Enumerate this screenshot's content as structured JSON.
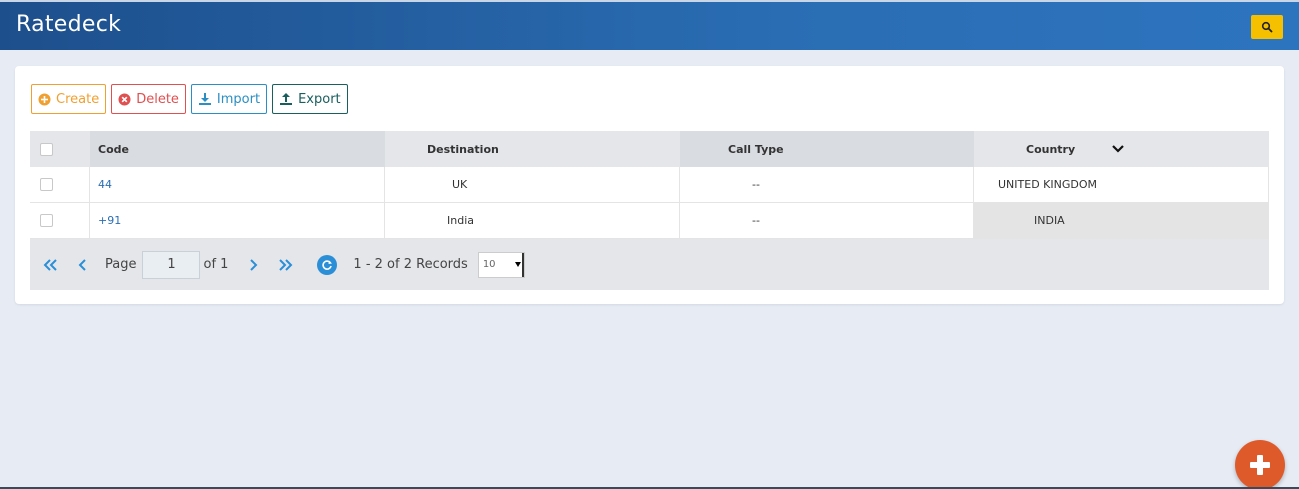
{
  "header": {
    "title": "Ratedeck"
  },
  "toolbar": {
    "create_label": "Create",
    "delete_label": "Delete",
    "import_label": "Import",
    "export_label": "Export"
  },
  "table": {
    "columns": [
      "Code",
      "Destination",
      "Call Type",
      "Country"
    ],
    "rows": [
      {
        "code": "44",
        "destination": "UK",
        "call_type": "--",
        "country": "UNITED KINGDOM"
      },
      {
        "code": "+91",
        "destination": "India",
        "call_type": "--",
        "country": "INDIA"
      }
    ]
  },
  "pager": {
    "page_label": "Page",
    "page_value": "1",
    "of_label": "of 1",
    "records_label": "1 - 2 of 2 Records",
    "page_size": "10"
  },
  "colors": {
    "header_bg": "#2a6db3",
    "search_btn": "#f5c000",
    "fab": "#df5a2b",
    "link": "#2a6db3"
  }
}
